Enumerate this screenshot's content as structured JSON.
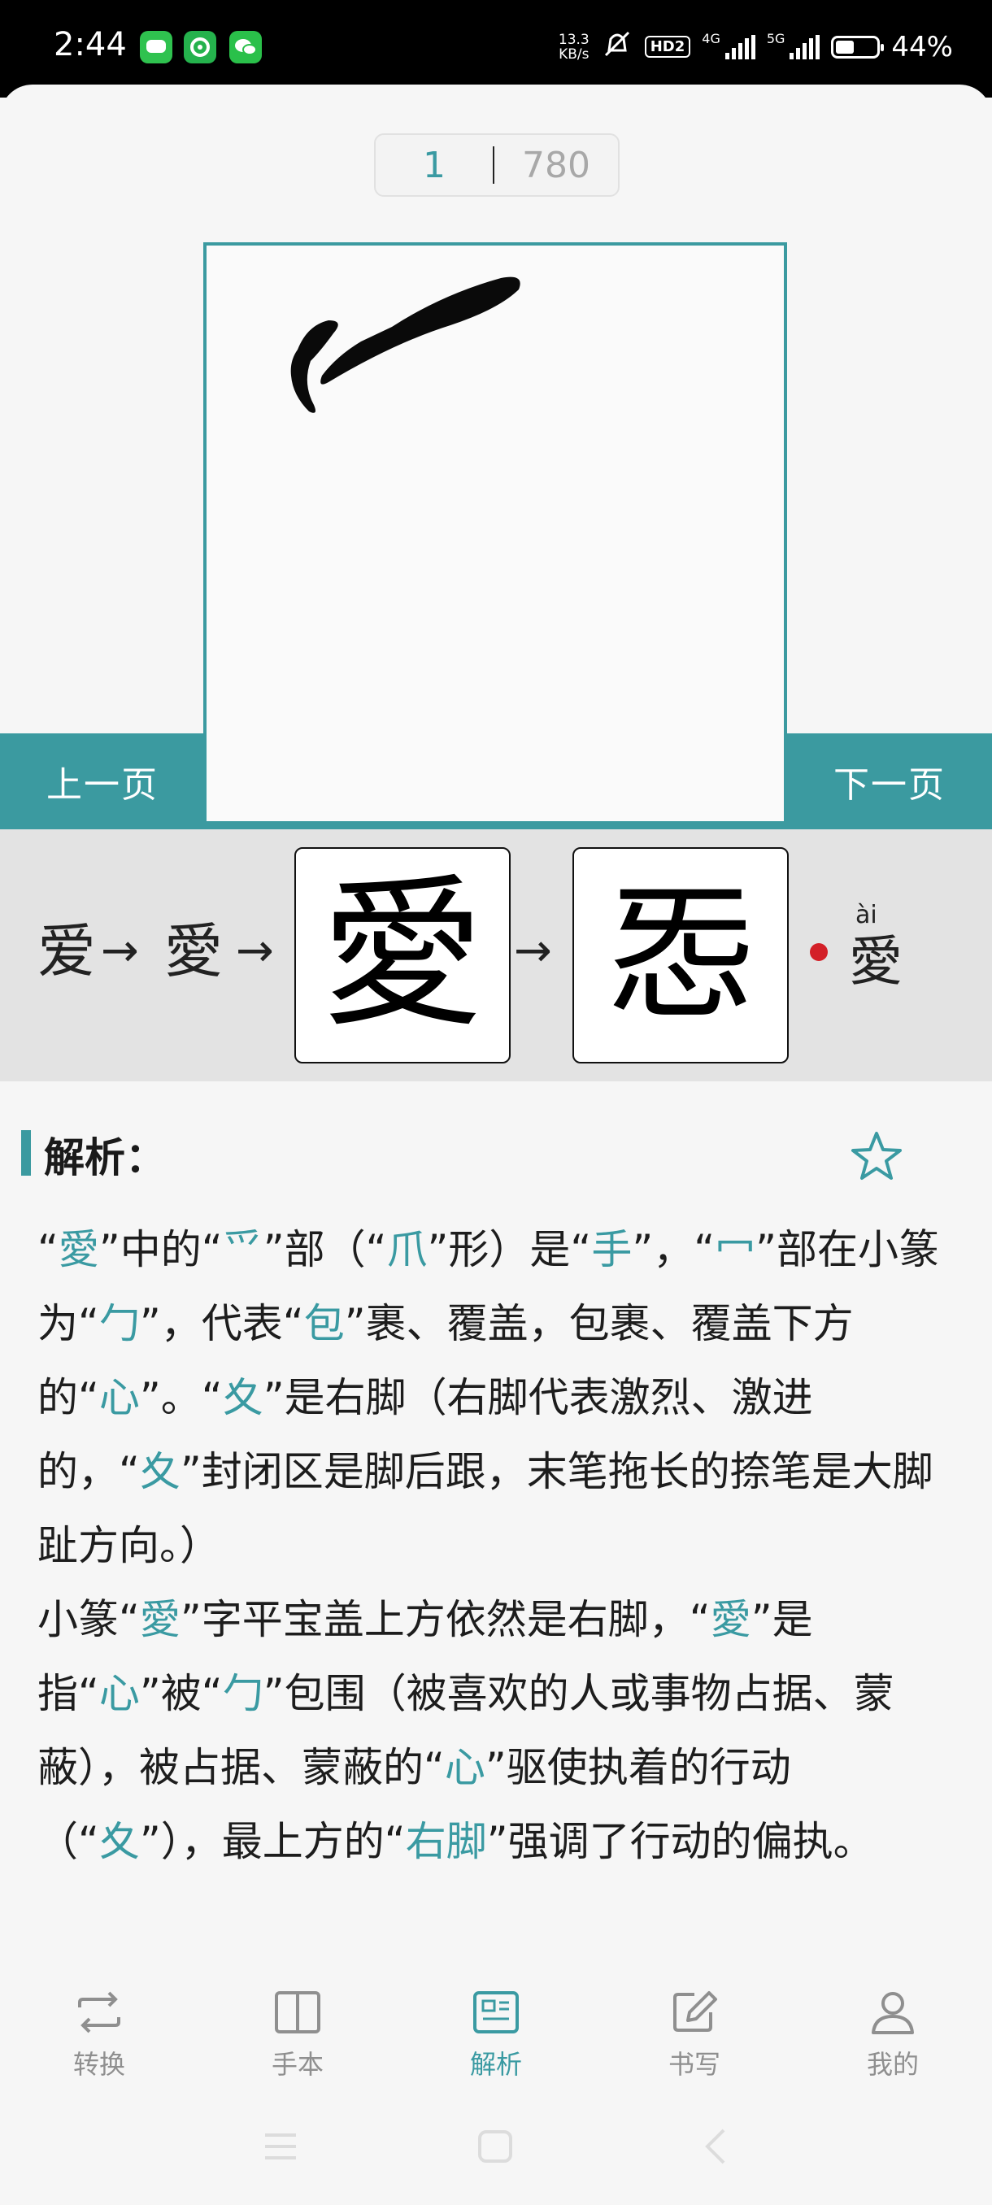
{
  "status_bar": {
    "time": "2:44",
    "net_speed_value": "13.3",
    "net_speed_unit": "KB/s",
    "hd_label": "HD2",
    "gen_4g": "4G",
    "gen_5g": "5G",
    "battery_percent": "44%",
    "battery_level": 0.44,
    "app_icons": [
      "green-chat-app-icon",
      "green-swirl-app-icon",
      "wechat-icon"
    ]
  },
  "pager": {
    "current": "1",
    "total": "780"
  },
  "stroke_panel": {
    "prev_label": "上一页",
    "next_label": "下一页"
  },
  "evolution": {
    "step1": "爱",
    "arrow": "→",
    "step2": "愛",
    "box1_char": "愛",
    "box2_char": "㤅",
    "pinyin": "ài",
    "final_char": "愛",
    "dot_color": "#d32028"
  },
  "analysis": {
    "title": "解析：",
    "accent_color": "#3a9aa2",
    "segments": [
      {
        "t": "“"
      },
      {
        "t": "愛",
        "h": true
      },
      {
        "t": "”中的“"
      },
      {
        "t": "爫",
        "h": true
      },
      {
        "t": "”部（“"
      },
      {
        "t": "爪",
        "h": true
      },
      {
        "t": "”形）是“"
      },
      {
        "t": "手",
        "h": true
      },
      {
        "t": "”，“"
      },
      {
        "t": "冖",
        "h": true
      },
      {
        "t": "”部在小篆为“"
      },
      {
        "t": "勹",
        "h": true
      },
      {
        "t": "”，代表“"
      },
      {
        "t": "包",
        "h": true
      },
      {
        "t": "”裹、覆盖，包裹、覆盖下方的“"
      },
      {
        "t": "心",
        "h": true
      },
      {
        "t": "”。“"
      },
      {
        "t": "夊",
        "h": true
      },
      {
        "t": "”是右脚（右脚代表激烈、激进的，“"
      },
      {
        "t": "夊",
        "h": true
      },
      {
        "t": "”封闭区是脚后跟，末笔拖长的捺笔是大脚趾方向。）"
      },
      {
        "br": true
      },
      {
        "t": "小篆“"
      },
      {
        "t": "愛",
        "h": true
      },
      {
        "t": "”字平宝盖上方依然是右脚，“"
      },
      {
        "t": "愛",
        "h": true
      },
      {
        "t": "”是指“"
      },
      {
        "t": "心",
        "h": true
      },
      {
        "t": "”被“"
      },
      {
        "t": "勹",
        "h": true
      },
      {
        "t": "”包围（被喜欢的人或事物占据、蒙蔽），被占据、蒙蔽的“"
      },
      {
        "t": "心",
        "h": true
      },
      {
        "t": "”驱使执着的行动（“"
      },
      {
        "t": "夊",
        "h": true
      },
      {
        "t": "”），最上方的“"
      },
      {
        "t": "右脚",
        "h": true
      },
      {
        "t": "”强调了行动的偏执。"
      }
    ]
  },
  "tabs": [
    {
      "label": "转换",
      "icon": "convert-arrows-icon",
      "active": false
    },
    {
      "label": "手本",
      "icon": "book-icon",
      "active": false
    },
    {
      "label": "解析",
      "icon": "analysis-doc-icon",
      "active": true
    },
    {
      "label": "书写",
      "icon": "edit-pen-icon",
      "active": false
    },
    {
      "label": "我的",
      "icon": "user-icon",
      "active": false
    }
  ]
}
